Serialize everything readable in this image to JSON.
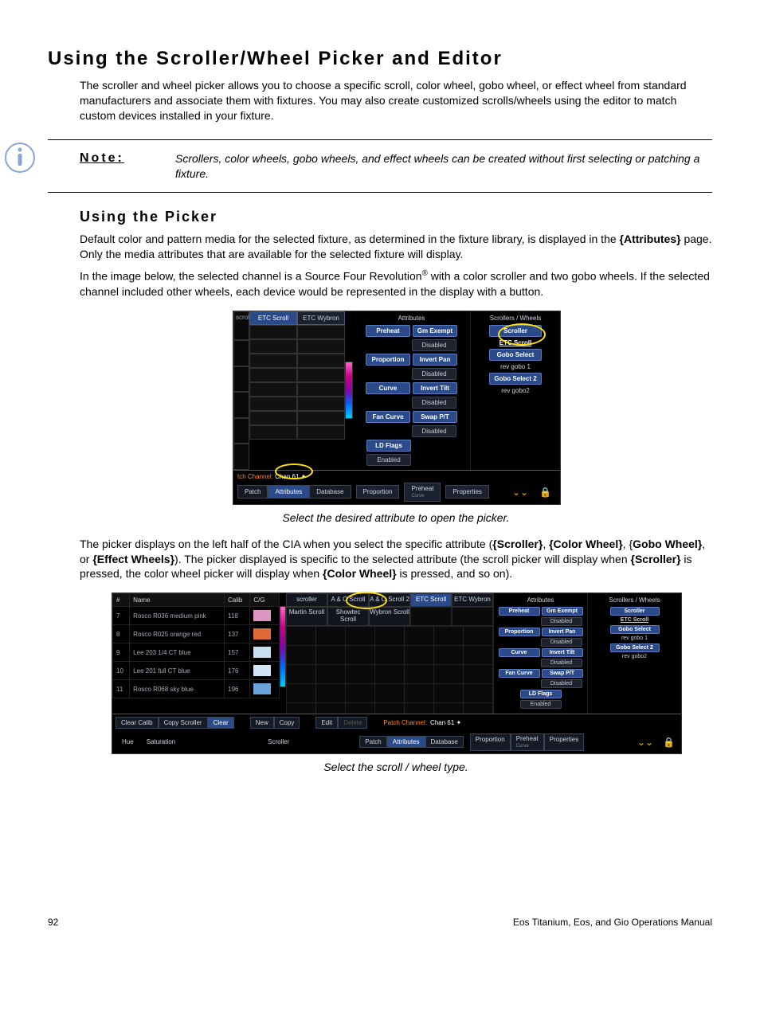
{
  "title": "Using the Scroller/Wheel Picker and Editor",
  "intro": "The scroller and wheel picker allows you to choose a specific scroll, color wheel, gobo wheel, or effect wheel from standard manufacturers and associate them with fixtures. You may also create customized scrolls/wheels using the editor to match custom devices installed in your fixture.",
  "note_label": "Note:",
  "note_text": "Scrollers, color wheels, gobo wheels, and effect wheels can be created without first selecting or patching a fixture.",
  "subsection": "Using the Picker",
  "para1_a": "Default color and pattern media for the selected fixture, as determined in the fixture library, is displayed in the ",
  "para1_b": "{Attributes}",
  "para1_c": " page. Only the media attributes that are available for the selected fixture will display.",
  "para2_a": "In the image below, the selected channel is a Source Four Revolution",
  "para2_b": " with a color scroller and two gobo wheels. If the selected channel included other wheels, each device would be represented in the display with a button.",
  "caption1": "Select the desired attribute to open the picker.",
  "para3_a": "The picker displays on the left half of the CIA when you select the specific attribute (",
  "para3_s": "{Scroller}",
  "para3_b": ", ",
  "para3_cw": "{Color Wheel}",
  "para3_c": ", {",
  "para3_gw": "Gobo Wheel}",
  "para3_d": ", or ",
  "para3_ew": "{Effect Wheels}",
  "para3_e": "). The picker displayed is specific to the selected attribute (the scroll picker will display when ",
  "para3_s2": "{Scroller}",
  "para3_f": " is pressed, the color wheel picker will display when ",
  "para3_cw2": "{Color Wheel}",
  "para3_g": " is pressed, and so on).",
  "caption2": "Select the scroll / wheel type.",
  "footer_page": "92",
  "footer_title": "Eos Titanium, Eos, and Gio Operations Manual",
  "fig1": {
    "scroll_label": "scroll",
    "etc_scroll": "ETC Scroll",
    "etc_wybron": "ETC Wybron",
    "attrs_header": "Attributes",
    "swheels_header": "Scrollers / Wheels",
    "preheat": "Preheat",
    "gm_exempt": "Gm Exempt",
    "disabled": "Disabled",
    "proportion": "Proportion",
    "invert_pan": "Invert Pan",
    "curve": "Curve",
    "invert_tilt": "Invert Tilt",
    "fan_curve": "Fan Curve",
    "swap_pt": "Swap P/T",
    "ld_flags": "LD Flags",
    "enabled": "Enabled",
    "scroller": "Scroller",
    "etc_scroll_r": "ETC Scroll",
    "gobo_select": "Gobo Select",
    "rev_gobo1": "rev gobo 1",
    "gobo_select2": "Gobo Select 2",
    "rev_gobo2": "rev gobo2",
    "patch_channel_label": "tch Channel:",
    "chan_val": "Chan 61 ✦",
    "tab_patch": "Patch",
    "tab_attributes": "Attributes",
    "tab_database": "Database",
    "tab_proportion": "Proportion",
    "tab_preheat": "Preheat",
    "tab_preheat_sub": "Curve",
    "tab_properties": "Properties"
  },
  "fig2": {
    "hdr_num": "#",
    "hdr_name": "Name",
    "hdr_calib": "Calib",
    "hdr_cg": "C/G",
    "rows": [
      {
        "n": "7",
        "name": "Rosco R036 medium pink",
        "calib": "118",
        "color": "#dd96c0"
      },
      {
        "n": "8",
        "name": "Rosco R025 orange red",
        "calib": "137",
        "color": "#e26a3a"
      },
      {
        "n": "9",
        "name": "Lee 203 1/4 CT blue",
        "calib": "157",
        "color": "#c9def0"
      },
      {
        "n": "10",
        "name": "Lee 201 full CT blue",
        "calib": "176",
        "color": "#d2e6f7"
      },
      {
        "n": "11",
        "name": "Rosco R068 sky blue",
        "calib": "196",
        "color": "#69a2dc"
      }
    ],
    "tabs_top": [
      "scroller",
      "A & O Scroll",
      "A & O Scroll 2",
      "ETC Scroll",
      "ETC Wybron"
    ],
    "tabs_second": [
      "Martin Scroll",
      "Showtec Scroll",
      "Wybron Scroll"
    ],
    "attrs_header": "Attributes",
    "swheels_header": "Scrollers / Wheels",
    "preheat": "Preheat",
    "gm_exempt": "Gm Exempt",
    "disabled": "Disabled",
    "proportion": "Proportion",
    "invert_pan": "Invert Pan",
    "curve": "Curve",
    "invert_tilt": "Invert Tilt",
    "fan_curve": "Fan Curve",
    "swap_pt": "Swap P/T",
    "ld_flags": "LD Flags",
    "enabled": "Enabled",
    "scroller": "Scroller",
    "etc_scroll": "ETC Scroll",
    "gobo_select": "Gobo Select",
    "rev_gobo1": "rev gobo 1",
    "gobo_select2": "Gobo Select 2",
    "rev_gobo2": "rev gobo2",
    "b_clear_calib": "Clear Calib",
    "b_copy_scroller": "Copy Scroller",
    "b_clear": "Clear",
    "b_new": "New",
    "b_copy": "Copy",
    "b_edit": "Edit",
    "b_delete": "Delete",
    "b_hue": "Hue",
    "b_saturation": "Saturation",
    "b_scroller_label": "Scroller",
    "patch_channel_label": "Patch Channel:",
    "chan_val": "Chan 61 ✦",
    "t_patch": "Patch",
    "t_attributes": "Attributes",
    "t_database": "Database",
    "t_proportion": "Proportion",
    "t_preheat": "Preheat",
    "t_preheat_sub": "Curve",
    "t_properties": "Properties"
  }
}
